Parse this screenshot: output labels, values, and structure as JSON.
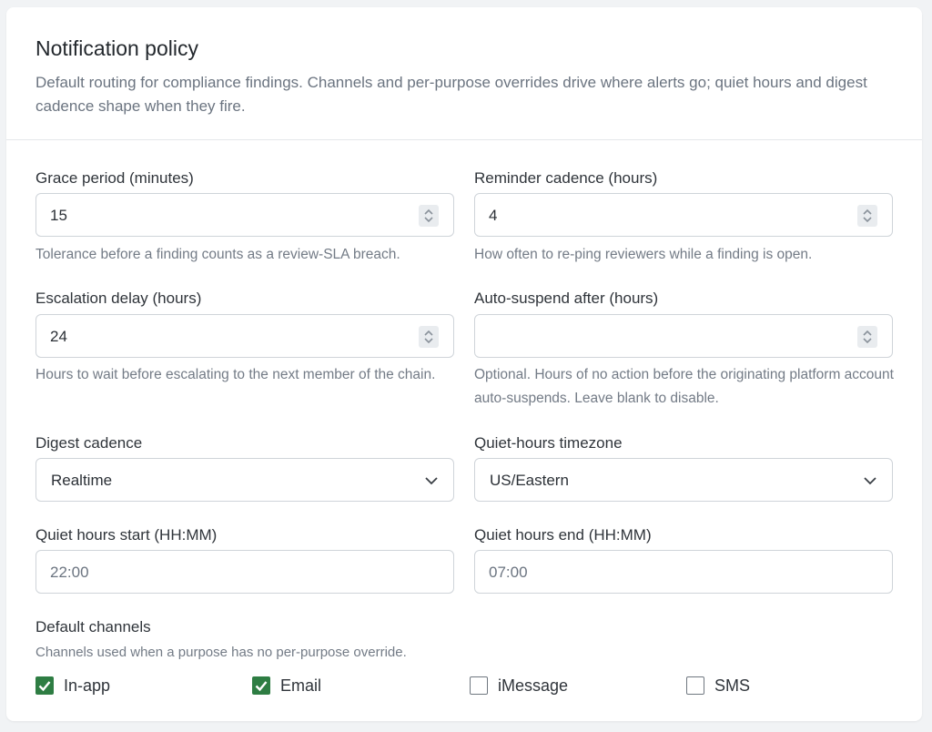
{
  "header": {
    "title": "Notification policy",
    "description": "Default routing for compliance findings. Channels and per-purpose overrides drive where alerts go; quiet hours and digest cadence shape when they fire."
  },
  "fields": {
    "grace_period": {
      "label": "Grace period (minutes)",
      "value": "15",
      "help": "Tolerance before a finding counts as a review-SLA breach."
    },
    "reminder_cadence": {
      "label": "Reminder cadence (hours)",
      "value": "4",
      "help": "How often to re-ping reviewers while a finding is open."
    },
    "escalation_delay": {
      "label": "Escalation delay (hours)",
      "value": "24",
      "help": "Hours to wait before escalating to the next member of the chain."
    },
    "auto_suspend": {
      "label": "Auto-suspend after (hours)",
      "value": "",
      "help": "Optional. Hours of no action before the originating platform account auto-suspends. Leave blank to disable."
    },
    "digest_cadence": {
      "label": "Digest cadence",
      "value": "Realtime"
    },
    "quiet_timezone": {
      "label": "Quiet-hours timezone",
      "value": "US/Eastern"
    },
    "quiet_start": {
      "label": "Quiet hours start (HH:MM)",
      "value": "22:00"
    },
    "quiet_end": {
      "label": "Quiet hours end (HH:MM)",
      "value": "07:00"
    }
  },
  "channels": {
    "label": "Default channels",
    "help": "Channels used when a purpose has no per-purpose override.",
    "items": [
      {
        "label": "In-app",
        "checked": true
      },
      {
        "label": "Email",
        "checked": true
      },
      {
        "label": "iMessage",
        "checked": false
      },
      {
        "label": "SMS",
        "checked": false
      }
    ]
  },
  "colors": {
    "accent": "#2e7d43",
    "border": "#cfd4d9",
    "muted_text": "#6b7480"
  }
}
